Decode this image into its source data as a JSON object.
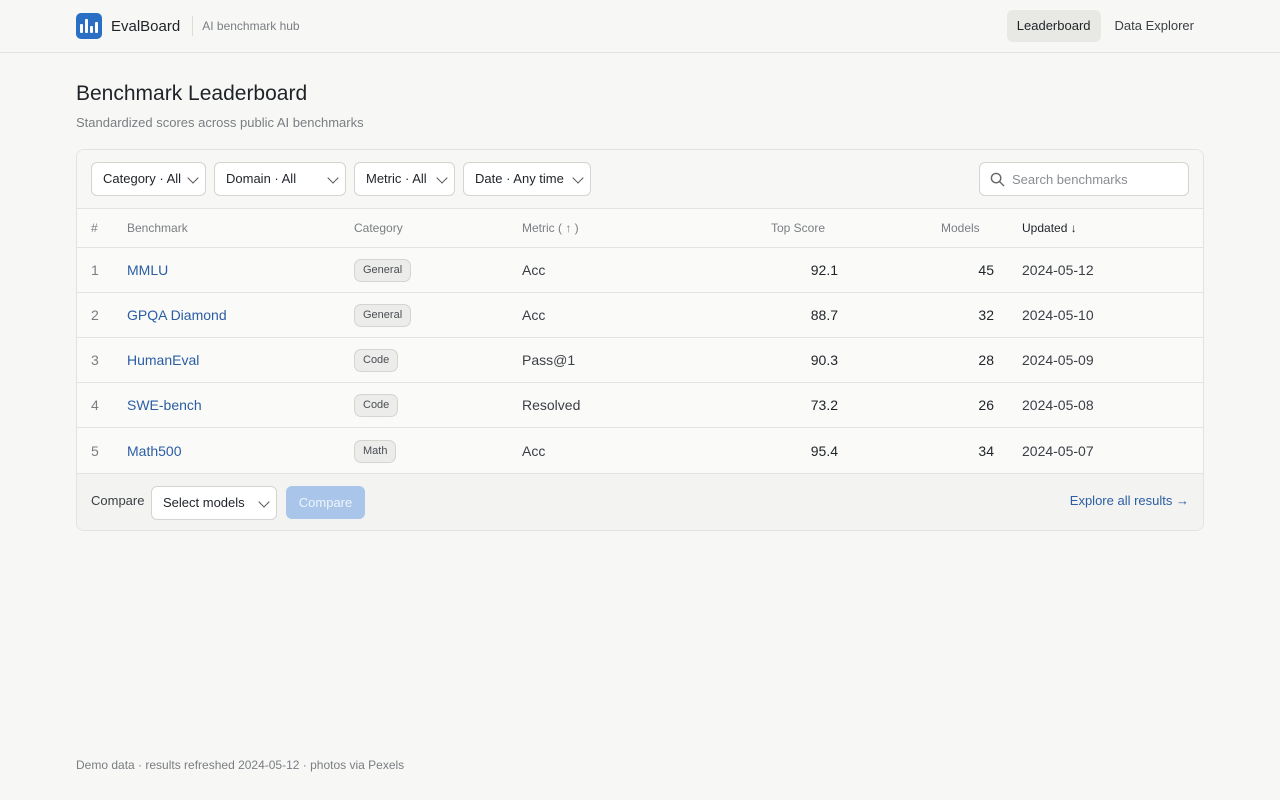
{
  "header": {
    "brand_name": "EvalBoard",
    "tagline": "AI benchmark hub",
    "nav": [
      {
        "label": "Leaderboard",
        "active": true
      },
      {
        "label": "Data Explorer",
        "active": false
      }
    ]
  },
  "page": {
    "title": "Benchmark Leaderboard",
    "subtitle": "Standardized scores across public AI benchmarks"
  },
  "filters": {
    "category": "Category · All",
    "domain": "Domain · All",
    "metric": "Metric · All",
    "date": "Date · Any time",
    "search_placeholder": "Search benchmarks"
  },
  "table": {
    "headers": {
      "rank": "#",
      "benchmark": "Benchmark",
      "category": "Category",
      "metric": "Metric ( ↑ )",
      "top_score": "Top Score",
      "models": "Models",
      "updated": "Updated ↓"
    },
    "rows": [
      {
        "rank": "1",
        "benchmark": "MMLU",
        "category": "General",
        "metric": "Acc",
        "top_score": "92.1",
        "models": "45",
        "updated": "2024-05-12"
      },
      {
        "rank": "2",
        "benchmark": "GPQA Diamond",
        "category": "General",
        "metric": "Acc",
        "top_score": "88.7",
        "models": "32",
        "updated": "2024-05-10"
      },
      {
        "rank": "3",
        "benchmark": "HumanEval",
        "category": "Code",
        "metric": "Pass@1",
        "top_score": "90.3",
        "models": "28",
        "updated": "2024-05-09"
      },
      {
        "rank": "4",
        "benchmark": "SWE-bench",
        "category": "Code",
        "metric": "Resolved",
        "top_score": "73.2",
        "models": "26",
        "updated": "2024-05-08"
      },
      {
        "rank": "5",
        "benchmark": "Math500",
        "category": "Math",
        "metric": "Acc",
        "top_score": "95.4",
        "models": "34",
        "updated": "2024-05-07"
      }
    ]
  },
  "compare": {
    "label": "Compare",
    "select_label": "Select models",
    "button_label": "Compare",
    "explore_link": "Explore all results →"
  },
  "footer": {
    "note": "Demo data · results refreshed 2024-05-12 · photos via Pexels"
  },
  "colors": {
    "accent": "#2b6fc4",
    "link": "#2b5da3",
    "button_disabled": "#a9c6ea"
  }
}
